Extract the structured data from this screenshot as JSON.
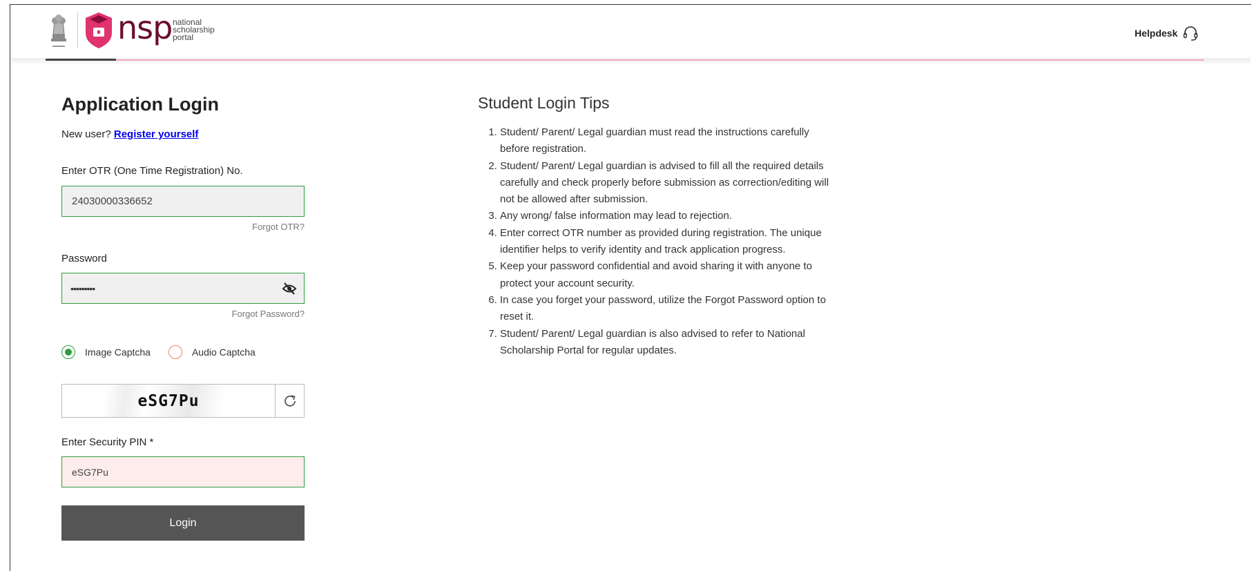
{
  "header": {
    "brand_short": "nsp",
    "brand_line1": "national",
    "brand_line2": "scholarship",
    "brand_line3": "portal",
    "helpdesk_label": "Helpdesk"
  },
  "login": {
    "title": "Application Login",
    "new_user_prefix": "New user?",
    "register_link": "Register yourself",
    "otr_label": "Enter OTR (One Time Registration) No.",
    "otr_value": "24030000336652",
    "forgot_otr": "Forgot OTR?",
    "password_label": "Password",
    "password_value": "•••••••••",
    "forgot_password": "Forgot Password?",
    "captcha_option_image": "Image Captcha",
    "captcha_option_audio": "Audio Captcha",
    "captcha_text": "eSG7Pu",
    "pin_label": "Enter Security PIN *",
    "pin_value": "eSG7Pu",
    "login_button": "Login"
  },
  "tips": {
    "title": "Student Login Tips",
    "items": [
      "Student/ Parent/ Legal guardian must read the instructions carefully before registration.",
      "Student/ Parent/ Legal guardian is advised to fill all the required details carefully and check properly before submission as correction/editing will not be allowed after submission.",
      "Any wrong/ false information may lead to rejection.",
      "Enter correct OTR number as provided during registration. The unique identifier helps to verify identity and track application progress.",
      "Keep your password confidential and avoid sharing it with anyone to protect your account security.",
      "In case you forget your password, utilize the Forgot Password option to reset it.",
      "Student/ Parent/ Legal guardian is also advised to refer to National Scholarship Portal for regular updates."
    ]
  },
  "colors": {
    "brand": "#6a0c2f",
    "brand_pink": "#e0336f",
    "field_border": "#2e9d3d",
    "button_bg": "#555555"
  }
}
